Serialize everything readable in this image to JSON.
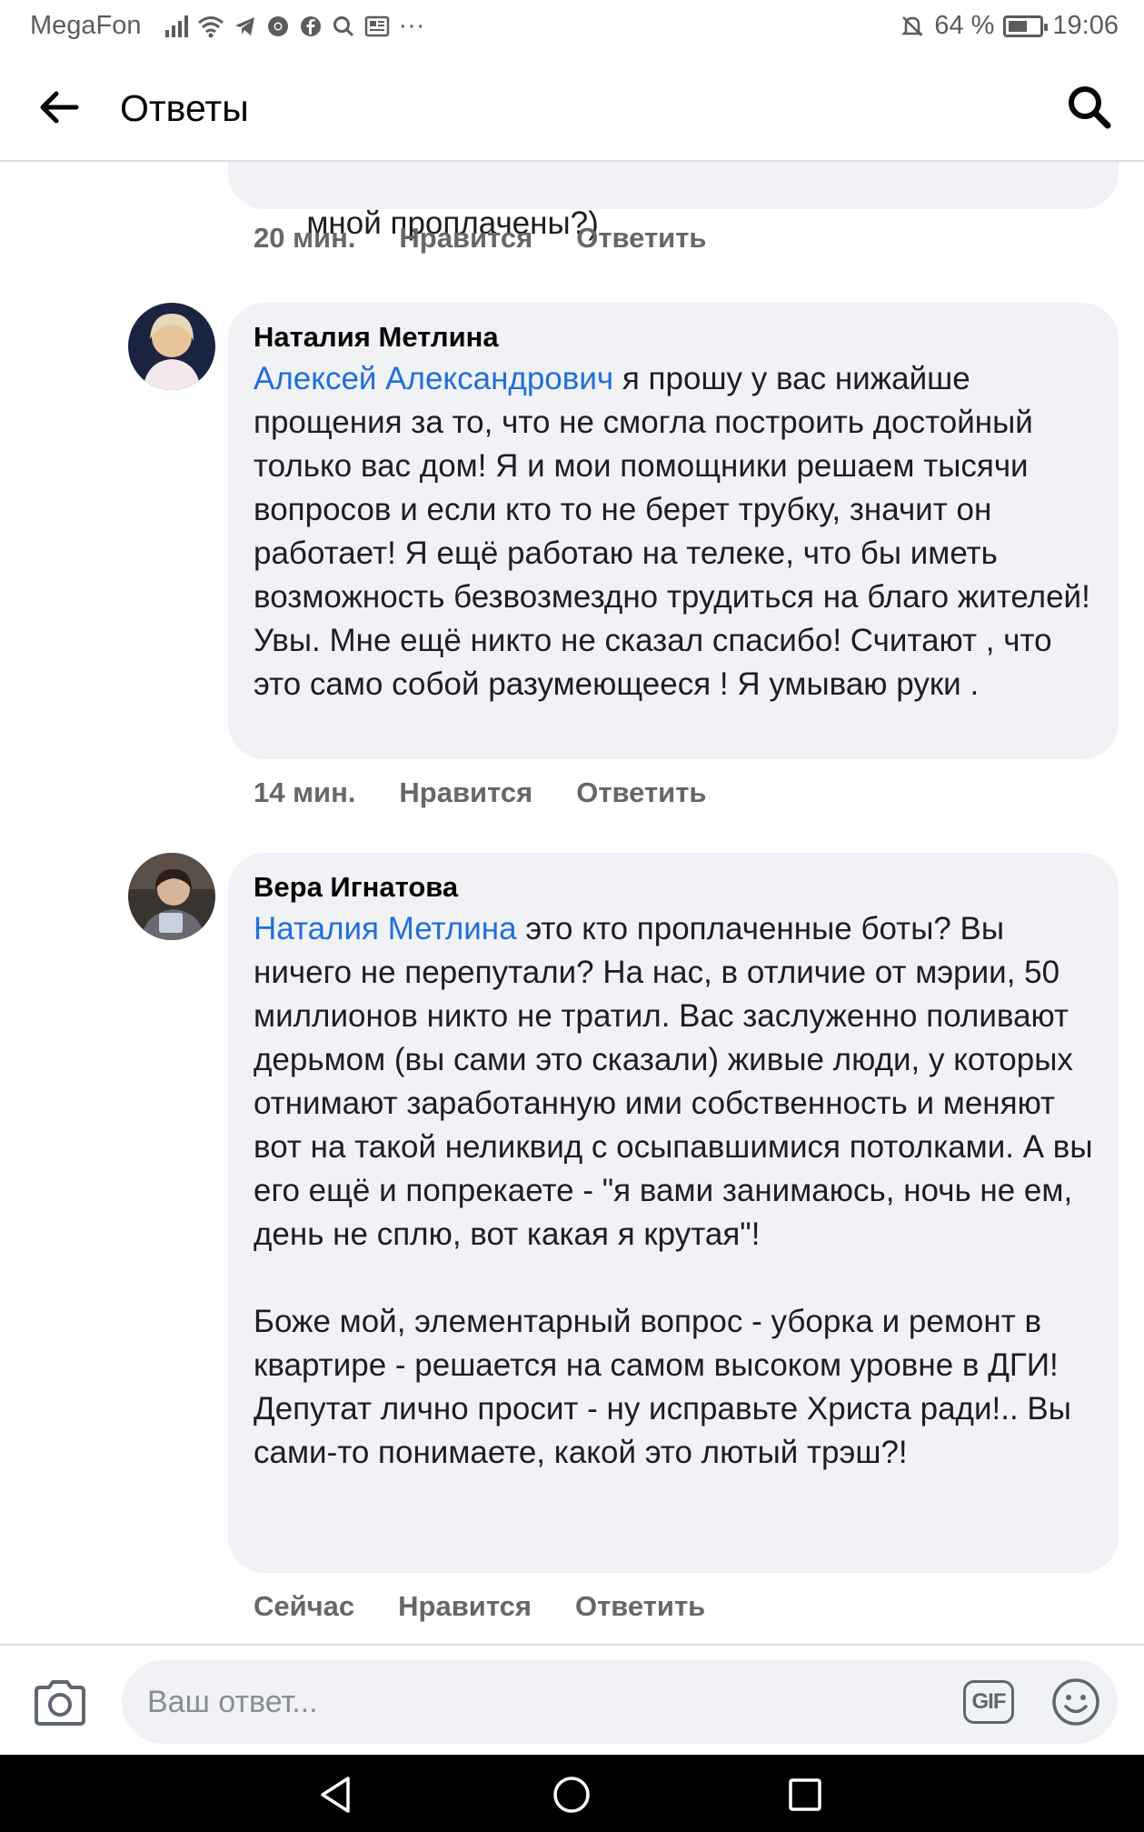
{
  "status_bar": {
    "carrier": "MegaFon",
    "battery_text": "64 %",
    "battery_level": 0.64,
    "time": "19:06",
    "more": "···"
  },
  "header": {
    "title": "Ответы"
  },
  "comments": [
    {
      "text_tail": "мной проплачены?)",
      "time": "20 мин.",
      "like_label": "Нравится",
      "reply_label": "Ответить"
    },
    {
      "author": "Наталия Метлина",
      "mention": "Алексей Александрович",
      "text": " я прошу у вас нижайше прощения за то, что не смогла построить достойный только вас дом! Я и мои помощники решаем тысячи вопросов и если кто то не берет трубку, значит он работает! Я ещё работаю на телеке, что бы иметь возможность безвозмездно трудиться на благо жителей! Увы. Мне ещё никто не сказал спасибо! Считают , что это само собой разумеющееся ! Я умываю руки .",
      "time": "14 мин.",
      "like_label": "Нравится",
      "reply_label": "Ответить"
    },
    {
      "author": "Вера Игнатова",
      "mention": "Наталия Метлина",
      "text": " это кто проплаченные боты? Вы ничего не перепутали? На нас, в отличие от мэрии, 50 миллионов никто не тратил. Вас заслуженно поливают дерьмом (вы сами это сказали) живые люди, у которых отнимают заработанную ими собственность и меняют вот на такой неликвид с осыпавшимися потолками. А вы его ещё и попрекаете - \"я вами занимаюсь, ночь не ем, день не сплю, вот какая я крутая\"!\n\nБоже мой, элементарный вопрос - уборка и ремонт в квартире - решается на самом высоком уровне в ДГИ! Депутат лично просит - ну исправьте Христа ради!.. Вы сами-то понимаете, какой это лютый трэш?!",
      "time": "Сейчас",
      "like_label": "Нравится",
      "reply_label": "Ответить"
    }
  ],
  "reply_bar": {
    "placeholder": "Ваш ответ...",
    "gif_label": "GIF"
  },
  "icons": {
    "back": "arrow-left-icon",
    "search": "search-icon",
    "camera": "camera-icon",
    "emoji": "smiley-icon",
    "nav_back": "triangle-back-icon",
    "nav_home": "circle-home-icon",
    "nav_recents": "square-recents-icon"
  },
  "colors": {
    "mention": "#216fdb",
    "bubble": "#f0f2f5",
    "meta": "#65676b"
  }
}
